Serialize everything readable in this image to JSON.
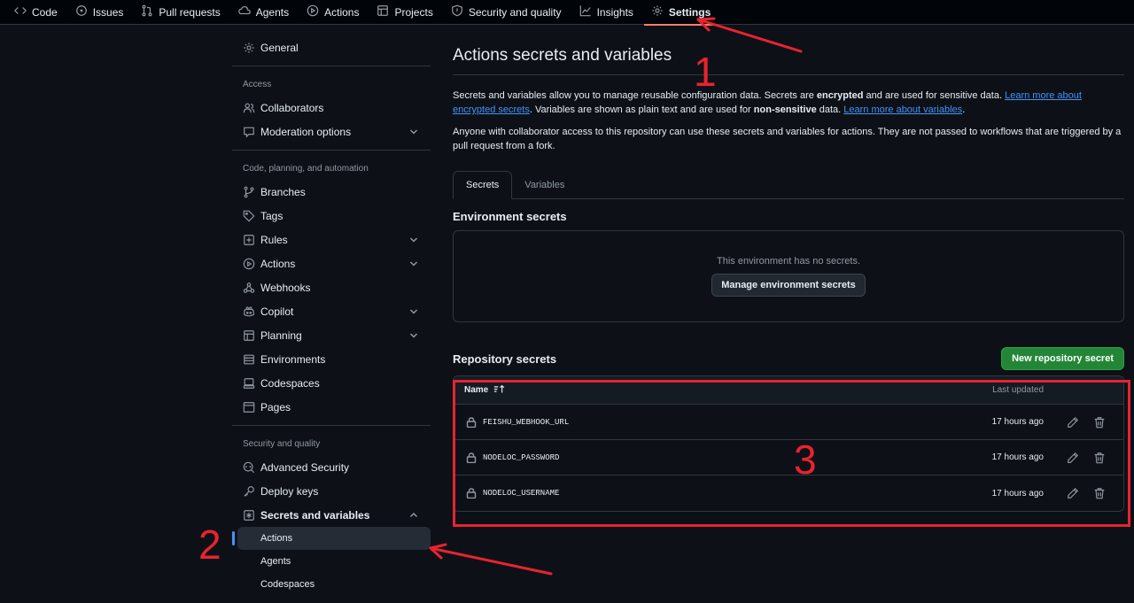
{
  "topnav": {
    "items": [
      {
        "label": "Code",
        "icon": "code-icon"
      },
      {
        "label": "Issues",
        "icon": "issue-icon"
      },
      {
        "label": "Pull requests",
        "icon": "pull-request-icon"
      },
      {
        "label": "Agents",
        "icon": "agent-icon"
      },
      {
        "label": "Actions",
        "icon": "play-icon"
      },
      {
        "label": "Projects",
        "icon": "table-icon"
      },
      {
        "label": "Security and quality",
        "icon": "shield-icon"
      },
      {
        "label": "Insights",
        "icon": "graph-icon"
      },
      {
        "label": "Settings",
        "icon": "gear-icon",
        "active": true
      }
    ]
  },
  "sidebar": {
    "general": "General",
    "access_heading": "Access",
    "collaborators": "Collaborators",
    "moderation": "Moderation options",
    "code_heading": "Code, planning, and automation",
    "branches": "Branches",
    "tags": "Tags",
    "rules": "Rules",
    "actions": "Actions",
    "webhooks": "Webhooks",
    "copilot": "Copilot",
    "planning": "Planning",
    "environments": "Environments",
    "codespaces": "Codespaces",
    "pages": "Pages",
    "security_heading": "Security and quality",
    "advanced_security": "Advanced Security",
    "deploy_keys": "Deploy keys",
    "secrets_variables": "Secrets and variables",
    "sub_actions": "Actions",
    "sub_agents": "Agents",
    "sub_codespaces": "Codespaces"
  },
  "main": {
    "title": "Actions secrets and variables",
    "desc1_a": "Secrets and variables allow you to manage reusable configuration data. Secrets are ",
    "desc1_b": "encrypted",
    "desc1_c": " and are used for sensitive data. ",
    "desc1_link1": "Learn more about encrypted secrets",
    "desc1_d": ". Variables are shown as plain text and are used for ",
    "desc1_e": "non-sensitive",
    "desc1_f": " data. ",
    "desc1_link2": "Learn more about variables",
    "desc1_g": ".",
    "desc2": "Anyone with collaborator access to this repository can use these secrets and variables for actions. They are not passed to workflows that are triggered by a pull request from a fork.",
    "tabs": [
      "Secrets",
      "Variables"
    ],
    "env_title": "Environment secrets",
    "env_empty": "This environment has no secrets.",
    "env_button": "Manage environment secrets",
    "repo_title": "Repository secrets",
    "new_button": "New repository secret",
    "col_name": "Name",
    "col_updated": "Last updated",
    "secrets": [
      {
        "name": "FEISHU_WEBHOOK_URL",
        "updated": "17 hours ago"
      },
      {
        "name": "NODELOC_PASSWORD",
        "updated": "17 hours ago"
      },
      {
        "name": "NODELOC_USERNAME",
        "updated": "17 hours ago"
      }
    ]
  },
  "annotations": {
    "one": "1",
    "two": "2",
    "three": "3",
    "color": "#e8232f"
  }
}
